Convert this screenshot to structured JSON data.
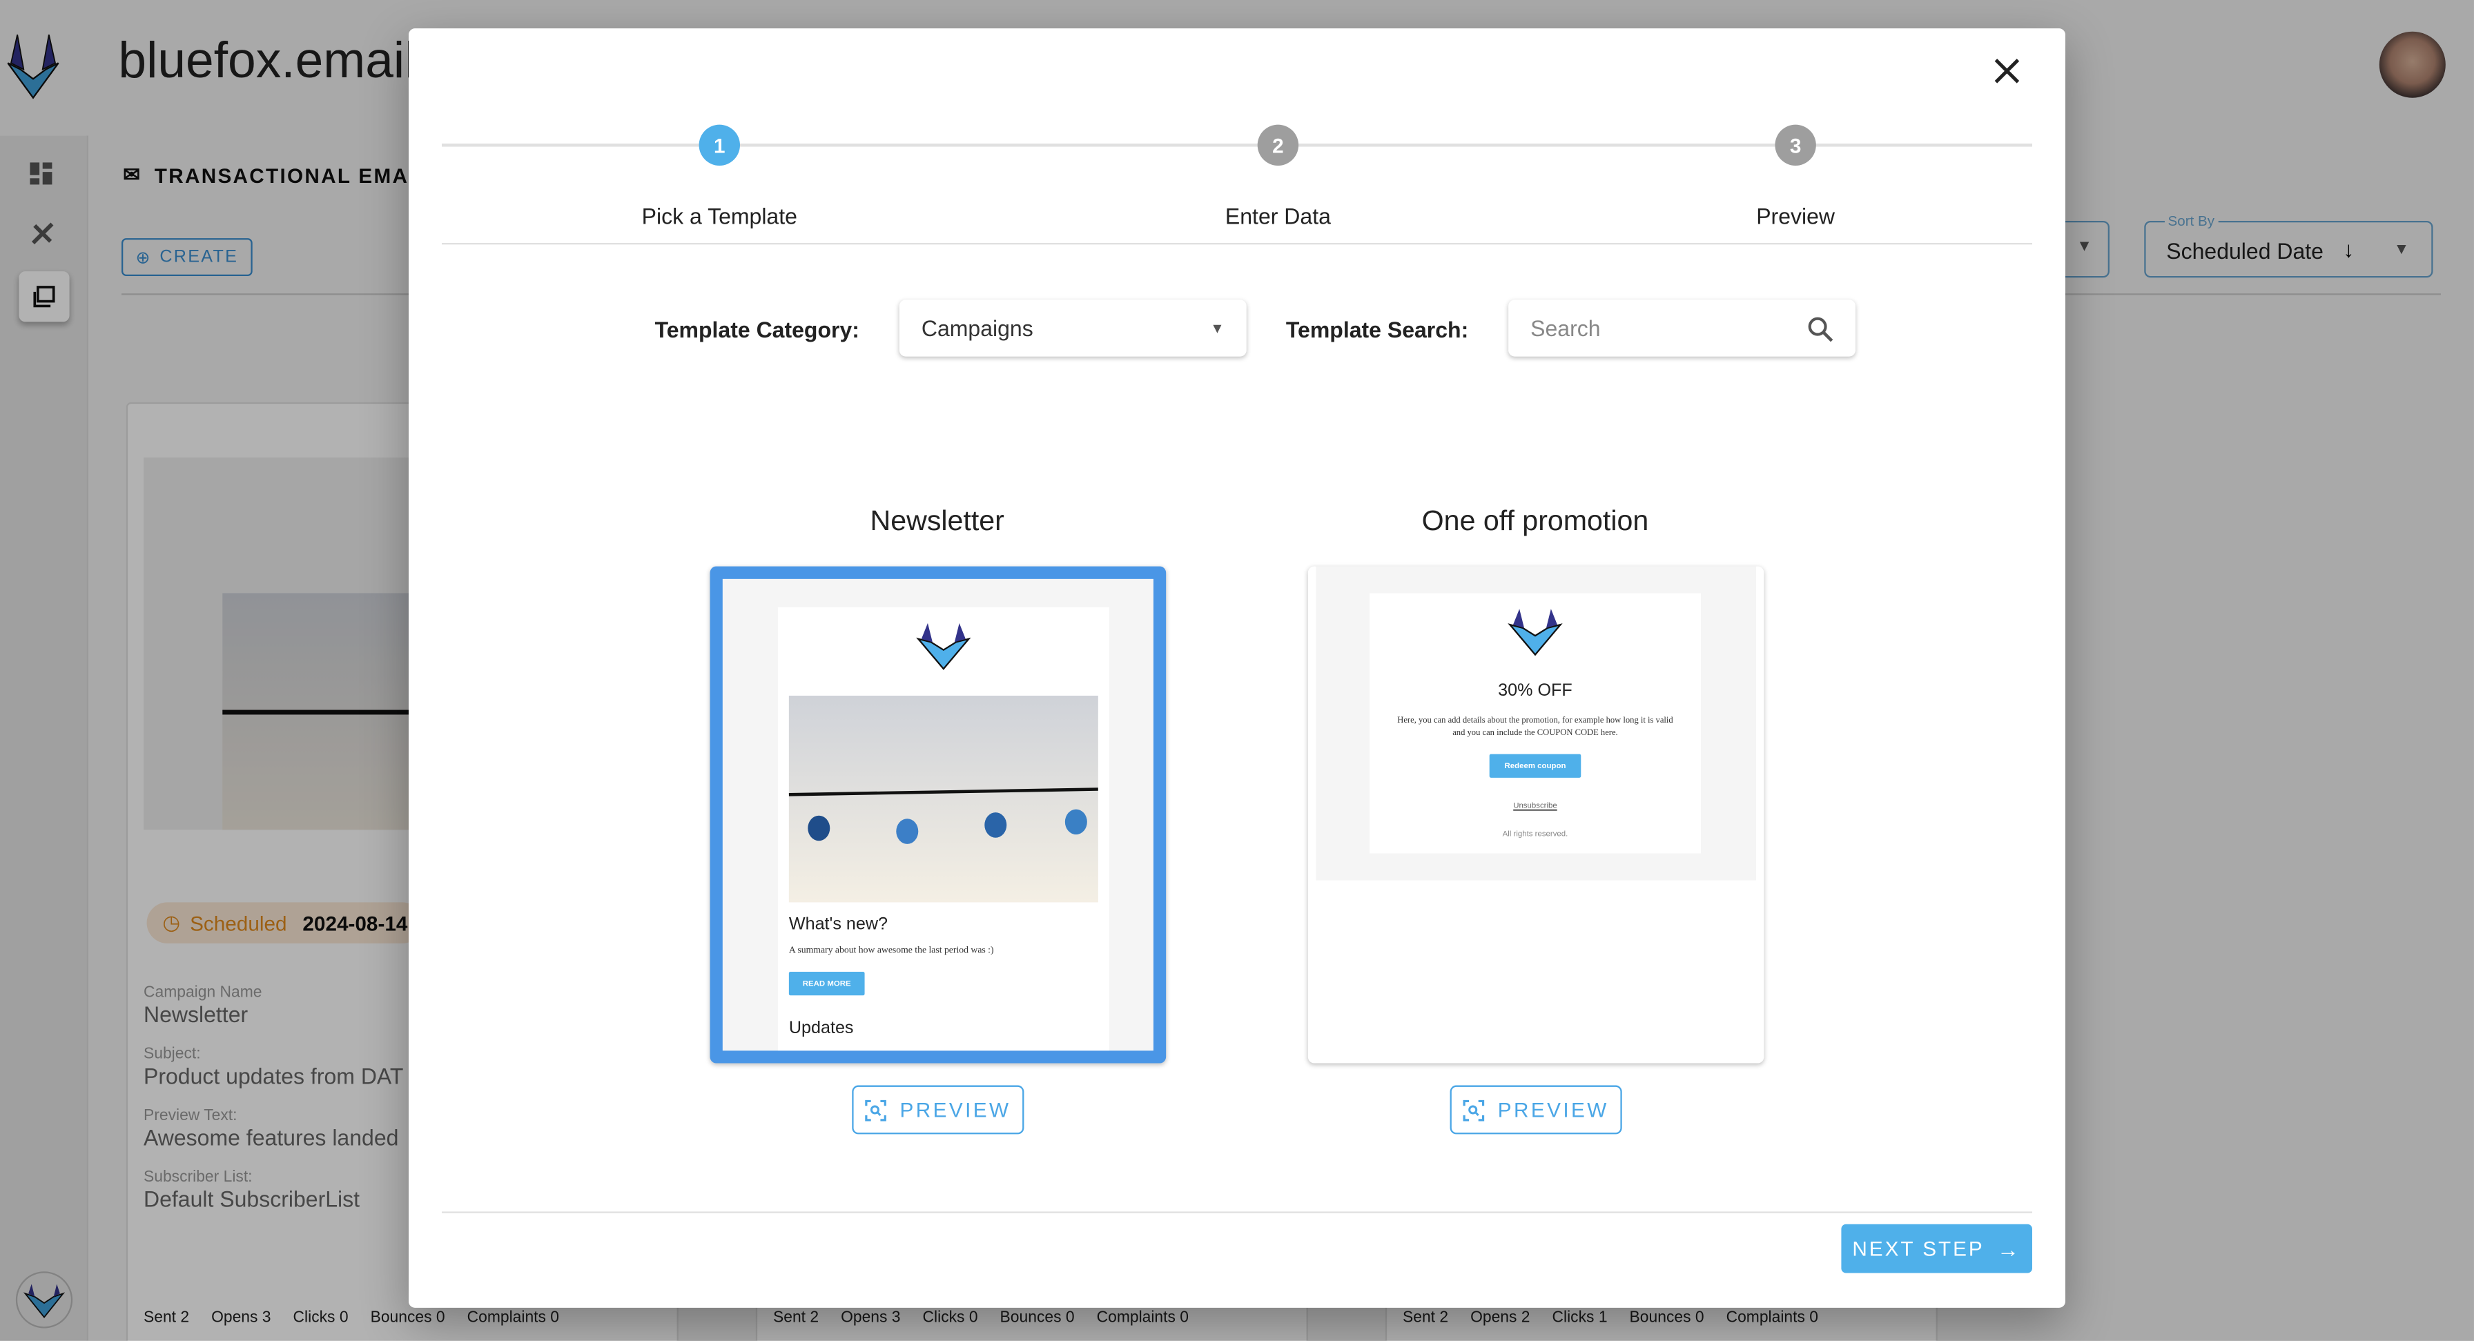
{
  "app": {
    "brand": "bluefox.email",
    "section_title": "TRANSACTIONAL EMAIL",
    "create_label": "CREATE"
  },
  "sidebar": {
    "items": [
      {
        "icon": "dashboard-icon"
      },
      {
        "icon": "tools-icon"
      },
      {
        "icon": "library-icon",
        "active": true
      }
    ]
  },
  "sort": {
    "label": "Sort By",
    "value": "Scheduled Date"
  },
  "campaign_card": {
    "status": "Scheduled",
    "date": "2024-08-14",
    "fields": [
      {
        "label": "Campaign Name",
        "value": "Newsletter"
      },
      {
        "label": "Subject:",
        "value": "Product updates from DAT"
      },
      {
        "label": "Preview Text:",
        "value": "Awesome features landed"
      },
      {
        "label": "Subscriber List:",
        "value": "Default SubscriberList"
      }
    ]
  },
  "card_stats": [
    [
      "Sent 2",
      "Opens 3",
      "Clicks 0",
      "Bounces 0",
      "Complaints 0"
    ],
    [
      "Sent 2",
      "Opens 3",
      "Clicks 0",
      "Bounces 0",
      "Complaints 0"
    ],
    [
      "Sent 2",
      "Opens 2",
      "Clicks 1",
      "Bounces 0",
      "Complaints 0"
    ]
  ],
  "modal": {
    "steps": [
      {
        "num": "1",
        "label": "Pick a Template",
        "active": true
      },
      {
        "num": "2",
        "label": "Enter Data"
      },
      {
        "num": "3",
        "label": "Preview"
      }
    ],
    "category_label": "Template Category:",
    "category_value": "Campaigns",
    "search_label": "Template Search:",
    "search_placeholder": "Search",
    "templates": [
      {
        "title": "Newsletter",
        "selected": true,
        "heading": "What's new?",
        "body": "A summary about how awesome the last period was :)",
        "button": "READ MORE",
        "section": "Updates"
      },
      {
        "title": "One off promotion",
        "heading": "30% OFF",
        "body": "Here, you can add details about the promotion, for example how long it is valid and you can include the COUPON CODE here.",
        "button": "Redeem coupon",
        "unsubscribe": "Unsubscribe",
        "footer": "All rights reserved."
      }
    ],
    "preview_label": "PREVIEW",
    "next_label": "NEXT STEP"
  },
  "colors": {
    "accent": "#4fb0ea",
    "selected_border": "#4a96e6",
    "step_inactive": "#9e9e9e",
    "scheduled": "#e08a1e"
  }
}
